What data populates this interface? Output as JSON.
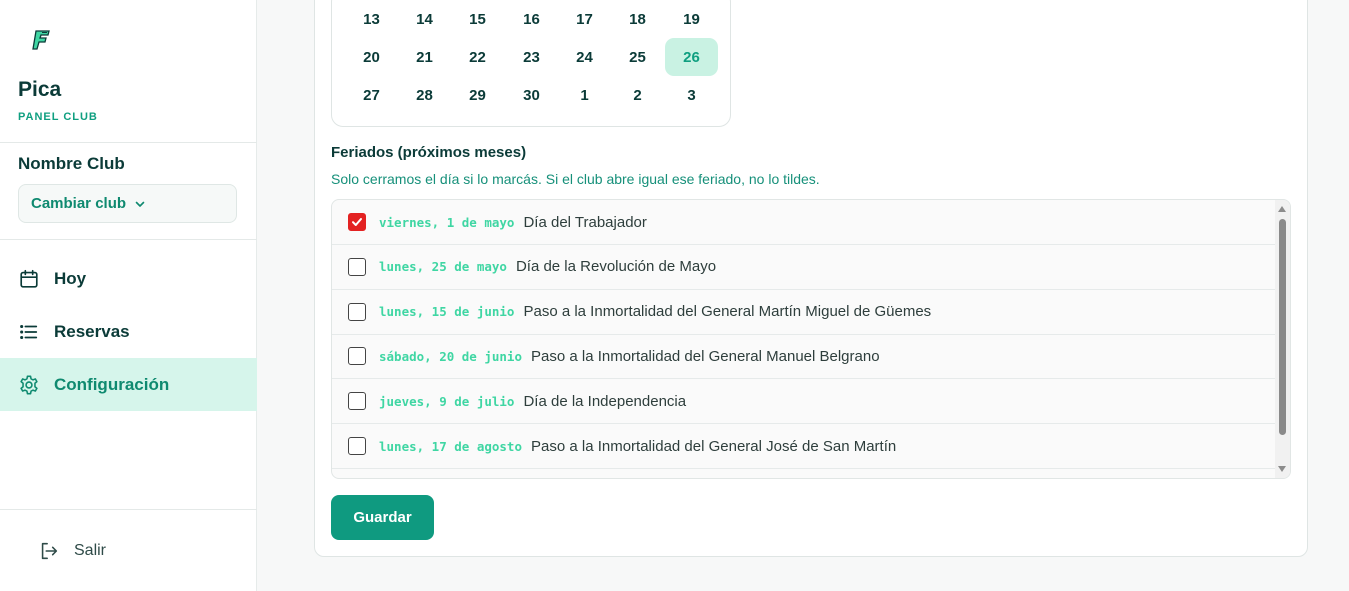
{
  "sidebar": {
    "app_name": "Pica",
    "app_sub": "PANEL CLUB",
    "club_name": "Nombre Club",
    "club_switch_label": "Cambiar club",
    "nav": [
      {
        "label": "Hoy",
        "icon": "calendar-icon"
      },
      {
        "label": "Reservas",
        "icon": "list-icon"
      },
      {
        "label": "Configuración",
        "icon": "gear-icon",
        "active": true
      }
    ],
    "logout_label": "Salir"
  },
  "calendar": {
    "weeks": [
      [
        "13",
        "14",
        "15",
        "16",
        "17",
        "18",
        "19"
      ],
      [
        "20",
        "21",
        "22",
        "23",
        "24",
        "25",
        "26"
      ],
      [
        "27",
        "28",
        "29",
        "30",
        "1",
        "2",
        "3"
      ]
    ],
    "selected": "26"
  },
  "holidays": {
    "title": "Feriados (próximos meses)",
    "help": "Solo cerramos el día si lo marcás. Si el club abre igual ese feriado, no lo tildes.",
    "items": [
      {
        "date": "viernes, 1 de mayo",
        "name": "Día del Trabajador",
        "checked": true
      },
      {
        "date": "lunes, 25 de mayo",
        "name": "Día de la Revolución de Mayo",
        "checked": false
      },
      {
        "date": "lunes, 15 de junio",
        "name": "Paso a la Inmortalidad del General Martín Miguel de Güemes",
        "checked": false
      },
      {
        "date": "sábado, 20 de junio",
        "name": "Paso a la Inmortalidad del General Manuel Belgrano",
        "checked": false
      },
      {
        "date": "jueves, 9 de julio",
        "name": "Día de la Independencia",
        "checked": false
      },
      {
        "date": "lunes, 17 de agosto",
        "name": "Paso a la Inmortalidad del General José de San Martín",
        "checked": false
      }
    ]
  },
  "save_label": "Guardar",
  "colors": {
    "accent": "#0f9a80",
    "active_bg": "#d6f5eb",
    "date_text": "#3fd6a3",
    "checkbox_checked": "#e32222"
  }
}
